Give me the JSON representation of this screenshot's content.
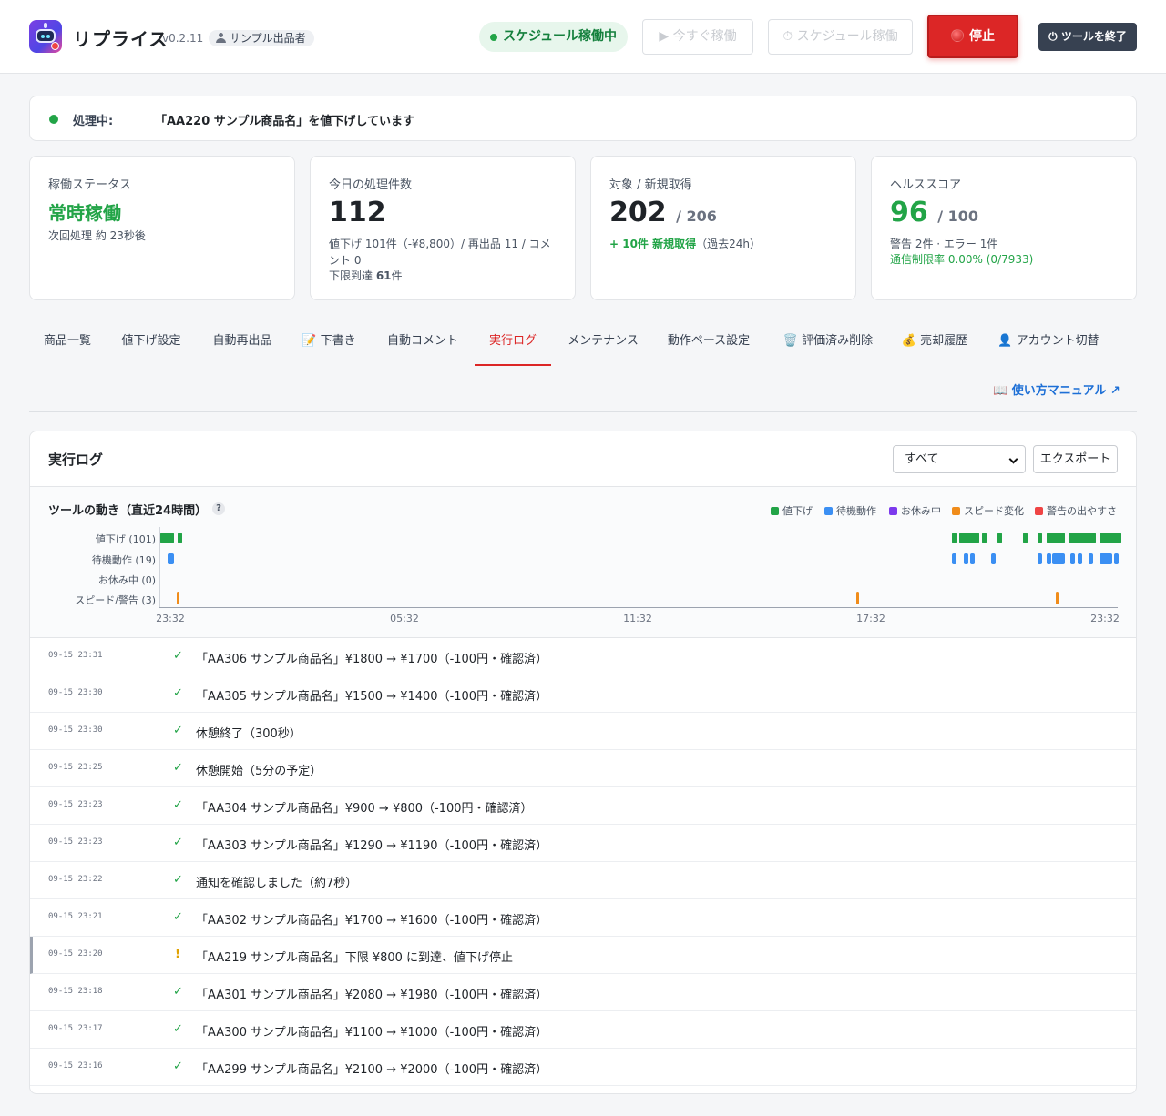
{
  "app": {
    "title": "リプライス",
    "version": "v0.2.11",
    "seller": "サンプル出品者"
  },
  "header": {
    "schedule_status": "スケジュール稼働中",
    "run_now": "▶ 今すぐ稼働",
    "run_schedule": "⏱ スケジュール稼働",
    "stop": "停止",
    "exit": "⏻ ツールを終了"
  },
  "processing": {
    "label": "処理中:",
    "text": "「AA220 サンプル商品名」を値下げしています"
  },
  "stats": {
    "status": {
      "label": "稼働ステータス",
      "value": "常時稼働",
      "next": "次回処理 約 23秒後"
    },
    "today": {
      "label": "今日の処理件数",
      "value": "112",
      "detail": "値下げ 101件（-¥8,800）/ 再出品 11 / コメント 0",
      "floor_prefix": "下限到達 ",
      "floor_value": "61",
      "floor_suffix": "件"
    },
    "targets": {
      "label": "対象 / 新規取得",
      "value": "202",
      "total": "/ 206",
      "new_acq": "+ 10件 新規取得",
      "new_period": "（過去24h）"
    },
    "health": {
      "label": "ヘルススコア",
      "value": "96",
      "max": "/ 100",
      "issues": "警告 2件 · エラー 1件",
      "rate_limit": "通信制限率 0.00% (0/7933)"
    }
  },
  "tabs": [
    {
      "label": "商品一覧"
    },
    {
      "label": "値下げ設定"
    },
    {
      "label": "自動再出品"
    },
    {
      "label": "📝 下書き"
    },
    {
      "label": "自動コメント"
    },
    {
      "label": "実行ログ",
      "active": true
    },
    {
      "label": "メンテナンス"
    },
    {
      "label": "動作ペース設定"
    },
    {
      "label": "🗑️ 評価済み削除"
    },
    {
      "label": "💰 売却履歴"
    },
    {
      "label": "👤 アカウント切替"
    }
  ],
  "manual_link": "📖 使い方マニュアル ↗",
  "log": {
    "title": "実行ログ",
    "filter_value": "すべて",
    "export": "エクスポート",
    "chart_title": "ツールの動き（直近24時間）",
    "help": "?",
    "legend": [
      {
        "label": "値下げ",
        "color": "#22a447"
      },
      {
        "label": "待機動作",
        "color": "#3b8ff3"
      },
      {
        "label": "お休み中",
        "color": "#7c3aed"
      },
      {
        "label": "スピード変化",
        "color": "#f08c1a"
      },
      {
        "label": "警告の出やすさ",
        "color": "#ef4444"
      }
    ],
    "rows": [
      "値下げ (101)",
      "待機動作 (19)",
      "お休み中 (0)",
      "スピード/警告 (3)"
    ],
    "ticks": [
      "23:32",
      "05:32",
      "11:32",
      "17:32",
      "23:32"
    ],
    "entries": [
      {
        "time": "09-15 23:31",
        "type": "ok",
        "msg": "「AA306 サンプル商品名」¥1800 → ¥1700（-100円・確認済）"
      },
      {
        "time": "09-15 23:30",
        "type": "ok",
        "msg": "「AA305 サンプル商品名」¥1500 → ¥1400（-100円・確認済）"
      },
      {
        "time": "09-15 23:30",
        "type": "ok",
        "msg": "休憩終了（300秒）"
      },
      {
        "time": "09-15 23:25",
        "type": "ok",
        "msg": "休憩開始（5分の予定）"
      },
      {
        "time": "09-15 23:23",
        "type": "ok",
        "msg": "「AA304 サンプル商品名」¥900 → ¥800（-100円・確認済）"
      },
      {
        "time": "09-15 23:23",
        "type": "ok",
        "msg": "「AA303 サンプル商品名」¥1290 → ¥1190（-100円・確認済）"
      },
      {
        "time": "09-15 23:22",
        "type": "ok",
        "msg": "通知を確認しました（約7秒）"
      },
      {
        "time": "09-15 23:21",
        "type": "ok",
        "msg": "「AA302 サンプル商品名」¥1700 → ¥1600（-100円・確認済）"
      },
      {
        "time": "09-15 23:20",
        "type": "warn",
        "msg": "「AA219 サンプル商品名」下限 ¥800 に到達、値下げ停止"
      },
      {
        "time": "09-15 23:18",
        "type": "ok",
        "msg": "「AA301 サンプル商品名」¥2080 → ¥1980（-100円・確認済）"
      },
      {
        "time": "09-15 23:17",
        "type": "ok",
        "msg": "「AA300 サンプル商品名」¥1100 → ¥1000（-100円・確認済）"
      },
      {
        "time": "09-15 23:16",
        "type": "ok",
        "msg": "「AA299 サンプル商品名」¥2100 → ¥2000（-100円・確認済）"
      }
    ],
    "icons": {
      "ok": "✓",
      "warn": "!"
    }
  }
}
